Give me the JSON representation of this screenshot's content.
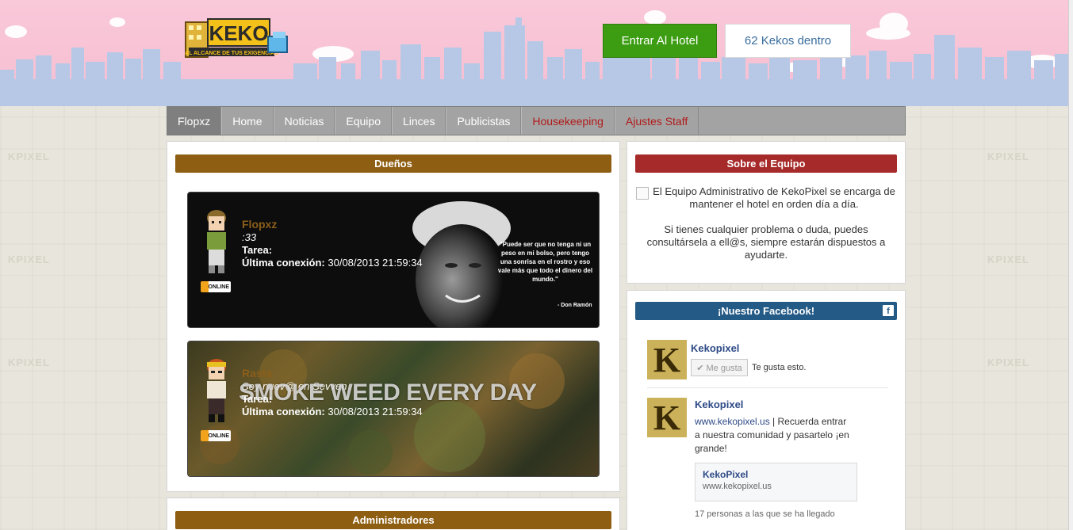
{
  "header": {
    "logo_alt": "KEKO",
    "logo_tagline": "AL ALCANCE DE TUS EXIGENCIAS",
    "enter_button": "Entrar Al Hotel",
    "online_count": "62 Kekos dentro"
  },
  "background_word": "KPIXEL",
  "nav": {
    "items": [
      {
        "label": "Flopxz"
      },
      {
        "label": "Home"
      },
      {
        "label": "Noticias"
      },
      {
        "label": "Equipo"
      },
      {
        "label": "Linces"
      },
      {
        "label": "Publicistas"
      },
      {
        "label": "Housekeeping"
      },
      {
        "label": "Ajustes Staff"
      }
    ]
  },
  "owners": {
    "title": "Dueños",
    "members": [
      {
        "name": "Flopxz",
        "motto": ":33",
        "task_label": "Tarea:",
        "last_label": "Última conexión:",
        "last_value": "30/08/2013 21:59:34",
        "status": "ONLINE",
        "quote": "\"Puede ser que no tenga ni un peso en mi bolso, pero tengo una sonrisa en el rostro y eso vale más que todo el dinero del mundo.\"",
        "quote_author": "- Don Ramón"
      },
      {
        "name": "Rasta",
        "motto": "Soy nuev@ en Sevven",
        "task_label": "Tarea:",
        "last_label": "Última conexión:",
        "last_value": "30/08/2013 21:59:34",
        "status": "ONLINE",
        "banner_text": "SMOKE WEED EVERY DAY"
      }
    ]
  },
  "admins": {
    "title": "Administradores"
  },
  "about": {
    "title": "Sobre el Equipo",
    "paragraph1": "El Equipo Administrativo de KekoPixel se encarga de mantener el hotel en orden día a día.",
    "paragraph2": "Si tienes cualquier problema o duda, puedes consultársela a ell@s, siempre estarán dispuestos a ayudarte."
  },
  "facebook": {
    "title": "¡Nuestro Facebook!",
    "icon": "f",
    "page_name": "Kekopixel",
    "like_button": "✔ Me gusta",
    "likes_text": "Te gusta esto.",
    "post_author": "Kekopixel",
    "post_link": "www.kekopixel.us",
    "post_text": " | Recuerda entrar a nuestra comunidad y pasartelo ¡en grande!",
    "share_title": "KekoPixel",
    "share_url": "www.kekopixel.us",
    "people_text": "17 personas a las que se ha llegado"
  },
  "colors": {
    "enter_button": "#3c9d12",
    "owners_bar": "#8e5f13",
    "about_bar": "#a72a2a",
    "facebook_bar": "#245a86",
    "nav": "#a3a3a3"
  }
}
